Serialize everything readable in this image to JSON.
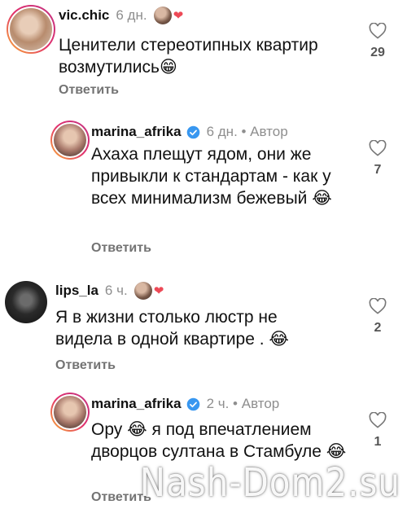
{
  "comments": [
    {
      "username": "vic.chic",
      "time": "6 дн.",
      "text": "Ценители стереотипных квартир возмутились😁",
      "reply_label": "Ответить",
      "likes": "29"
    },
    {
      "username": "marina_afrika",
      "time": "6 дн. • Автор",
      "text": "Ахаха плещут ядом, они же привыкли к стандартам - как у всех минимализм бежевый 😂",
      "reply_label": "Ответить",
      "likes": "7"
    },
    {
      "username": "lips_la",
      "time": "6 ч.",
      "text": "Я в жизни столько люстр не видела в одной квартире . 😂",
      "reply_label": "Ответить",
      "likes": "2"
    },
    {
      "username": "marina_afrika",
      "time": "2 ч. • Автор",
      "text": "Ору 😂 я под впечатлением дворцов султана в Стамбуле 😂",
      "reply_label": "Ответить",
      "likes": "1"
    }
  ],
  "watermark": "Nash-Dom2.su",
  "colors": {
    "verified": "#3897f0",
    "heart": "#ed4956",
    "muted": "#737373"
  }
}
